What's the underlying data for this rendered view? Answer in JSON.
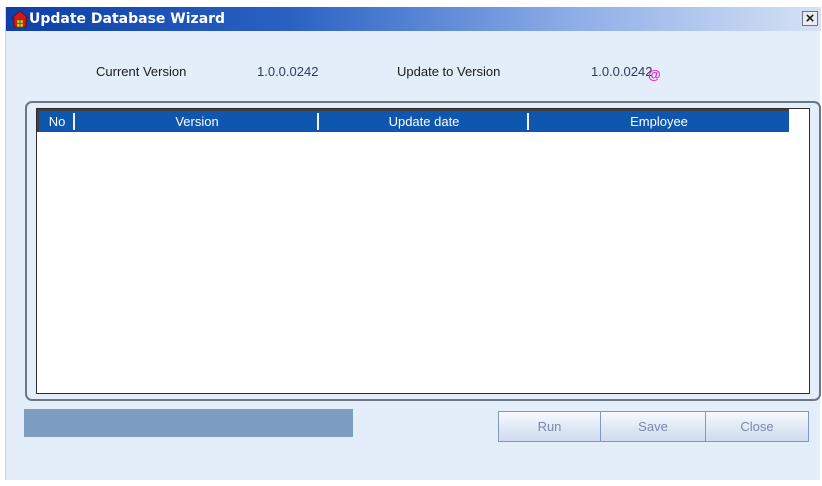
{
  "window": {
    "title": "Update Database Wizard",
    "close_glyph": "×"
  },
  "info": {
    "current_version_label": "Current Version",
    "current_version_value": "1.0.0.0242",
    "update_to_label": "Update to Version",
    "update_to_value": "1.0.0.0242",
    "status_glyph": "@"
  },
  "grid": {
    "columns": [
      "No",
      "Version",
      "Update date",
      "Employee"
    ],
    "rows": []
  },
  "progress": {
    "value": 0
  },
  "buttons": {
    "run": "Run",
    "save": "Save",
    "close": "Close"
  },
  "colors": {
    "header": "#0f56ae",
    "window_bg": "#e3eefa",
    "progress": "#7c9cc2",
    "status_icon": "#e020c8"
  }
}
